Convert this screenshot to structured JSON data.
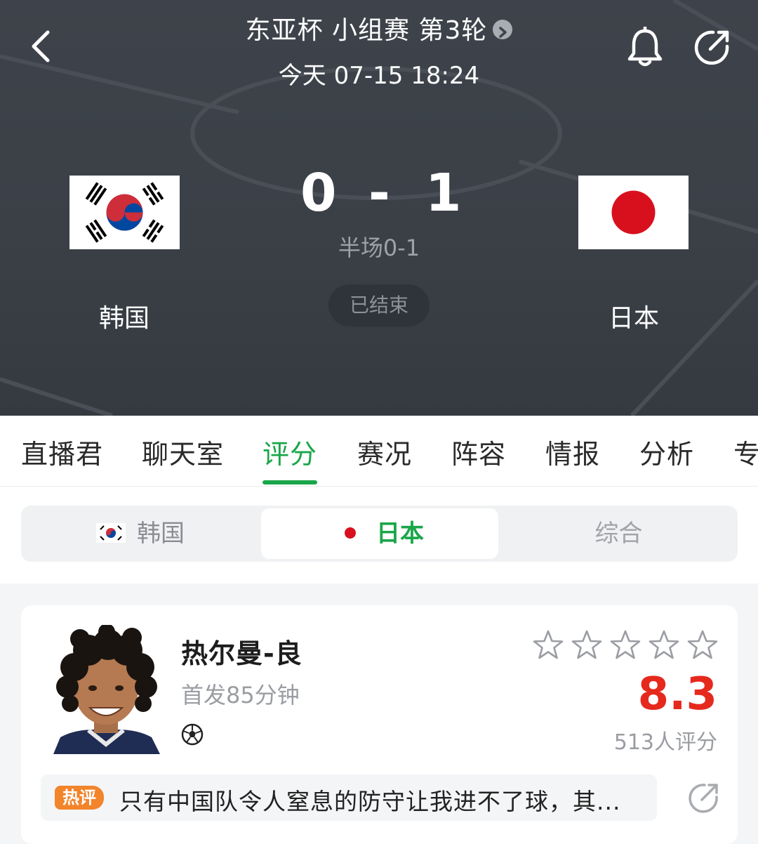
{
  "header": {
    "title": "东亚杯 小组赛 第3轮",
    "datetime": "今天 07-15 18:24",
    "home": {
      "name": "韩国",
      "score": "0"
    },
    "away": {
      "name": "日本",
      "score": "1"
    },
    "score_separator": "-",
    "halftime": "半场0-1",
    "status": "已结束"
  },
  "tabs": [
    {
      "label": "直播君",
      "active": false
    },
    {
      "label": "聊天室",
      "active": false
    },
    {
      "label": "评分",
      "active": true
    },
    {
      "label": "赛况",
      "active": false
    },
    {
      "label": "阵容",
      "active": false
    },
    {
      "label": "情报",
      "active": false
    },
    {
      "label": "分析",
      "active": false
    },
    {
      "label": "专",
      "active": false
    }
  ],
  "segment": {
    "home_label": "韩国",
    "away_label": "日本",
    "all_label": "综合",
    "selected": "日本"
  },
  "player": {
    "name": "热尔曼-良",
    "info": "首发85分钟",
    "stars_filled": 0,
    "stars_total": 5,
    "rating": "8.3",
    "votes": "513人评分",
    "badge": "热评",
    "comment": "只有中国队令人窒息的防守让我进不了球，其..."
  },
  "colors": {
    "accent": "#1aa64a",
    "rating": "#e6291d",
    "header_bg": "#3e434b",
    "hot_badge": "#f2842a"
  },
  "icons": {
    "back": "chevron-left-icon",
    "title_more": "chevron-right-circle-icon",
    "bell": "bell-icon",
    "share": "share-icon",
    "goal": "soccer-ball-icon",
    "star": "star-outline-icon"
  }
}
